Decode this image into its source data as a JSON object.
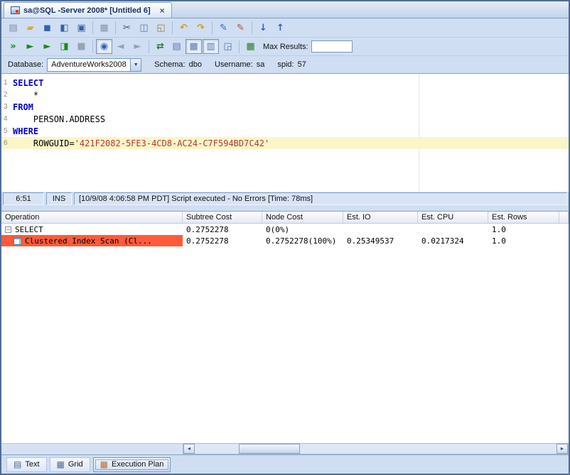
{
  "colors": {
    "accent": "#4f6d99",
    "keyword": "#0000cc",
    "string": "#b5382d",
    "current_line": "#fbf6c8",
    "selected_row": "#ff5a3a"
  },
  "icons": {
    "chevron_down": "▼",
    "scroll_left": "◄",
    "scroll_right": "►"
  },
  "doc_tab": {
    "title": "sa@SQL -Server 2008* [Untitled 6]",
    "close": "×"
  },
  "toolbar_main": {
    "file_group": [
      {
        "name": "new-file-button",
        "icon": "new-file-icon",
        "glyph": "▤",
        "style": "color:#7d8ca3"
      },
      {
        "name": "open-file-button",
        "icon": "open-folder-icon",
        "glyph": "▰",
        "style": "color:#dfa63e"
      },
      {
        "name": "save-button",
        "icon": "save-icon",
        "glyph": "◼",
        "style": "color:#3a5fa8"
      },
      {
        "name": "save-as-button",
        "icon": "save-as-icon",
        "glyph": "◧",
        "style": "color:#3a5fa8"
      },
      {
        "name": "save-all-button",
        "icon": "save-all-icon",
        "glyph": "▣",
        "style": "color:#3a5fa8"
      }
    ],
    "print_group": [
      {
        "name": "print-button",
        "icon": "printer-icon",
        "glyph": "▦",
        "style": "color:#8a95a8"
      }
    ],
    "clipboard_group": [
      {
        "name": "cut-button",
        "icon": "scissors-icon",
        "glyph": "✂",
        "style": "color:#44546e"
      },
      {
        "name": "copy-button",
        "icon": "copy-icon",
        "glyph": "◫",
        "style": "color:#5a77b0"
      },
      {
        "name": "paste-button",
        "icon": "paste-icon",
        "glyph": "◱",
        "style": "color:#a57c3f"
      }
    ],
    "undo_group": [
      {
        "name": "undo-button",
        "icon": "undo-arrow-icon",
        "glyph": "↶",
        "style": "color:#d89a20;font-weight:bold"
      },
      {
        "name": "redo-button",
        "icon": "redo-arrow-icon",
        "glyph": "↷",
        "style": "color:#d89a20;font-weight:bold"
      }
    ],
    "tools_group": [
      {
        "name": "edit-tool-button",
        "icon": "pencil-blue-icon",
        "glyph": "✎",
        "style": "color:#3468c8"
      },
      {
        "name": "edit-tool-2-button",
        "icon": "pencil-red-icon",
        "glyph": "✎",
        "style": "color:#c4483a"
      }
    ],
    "sort_group": [
      {
        "name": "sort-ascending-button",
        "icon": "arrow-down-icon",
        "glyph": "↓",
        "style": "color:#2a5fd0;font-weight:bold"
      },
      {
        "name": "sort-descending-button",
        "icon": "arrow-up-icon",
        "glyph": "↑",
        "style": "color:#2a5fd0;font-weight:bold"
      }
    ]
  },
  "toolbar_exec": {
    "run_group": [
      {
        "name": "execute-all-button",
        "icon": "double-chevron-icon",
        "glyph": "»",
        "style": "color:#1a8a1a;font-weight:bold"
      },
      {
        "name": "execute-button",
        "icon": "play-icon",
        "glyph": "►",
        "style": "color:#1a8a1a"
      },
      {
        "name": "execute-fetch-all-button",
        "icon": "play-fetch-icon",
        "glyph": "►",
        "style": "color:#1a8a1a"
      },
      {
        "name": "execute-batch-button",
        "icon": "play-grid-icon",
        "glyph": "◨",
        "style": "color:#1a8a1a"
      },
      {
        "name": "stop-button",
        "icon": "stop-icon",
        "glyph": "■",
        "style": "color:#9aa4b2"
      }
    ],
    "toggle_group": [
      {
        "name": "limit-results-toggle",
        "icon": "limit-icon",
        "glyph": "◉",
        "style": "color:#2a5fd0",
        "state": "pressed"
      }
    ],
    "nav_group": [
      {
        "name": "previous-statement-button",
        "icon": "arrow-left-icon",
        "glyph": "◄",
        "style": "color:#98a2b4"
      },
      {
        "name": "next-statement-button",
        "icon": "arrow-right-icon",
        "glyph": "►",
        "style": "color:#98a2b4"
      }
    ],
    "connect_group": [
      {
        "name": "reconnect-button",
        "icon": "swap-arrows-icon",
        "glyph": "⇄",
        "style": "color:#2a7a2a;font-weight:bold"
      }
    ],
    "results_group": [
      {
        "name": "results-text-toggle",
        "icon": "text-results-icon",
        "glyph": "▤",
        "style": "color:#5a77b0"
      },
      {
        "name": "results-grid-toggle",
        "icon": "grid-results-icon",
        "glyph": "▦",
        "style": "color:#5a77b0",
        "state": "pressed"
      },
      {
        "name": "results-single-row-toggle",
        "icon": "row-results-icon",
        "glyph": "▥",
        "style": "color:#5a77b0",
        "state": "pressed"
      },
      {
        "name": "export-results-button",
        "icon": "export-grid-icon",
        "glyph": "◲",
        "style": "color:#5a77b0"
      }
    ],
    "table_group": [
      {
        "name": "describe-table-button",
        "icon": "table-icon",
        "glyph": "▦",
        "style": "color:#2a7a2a"
      }
    ],
    "max_results_label": "Max Results:",
    "max_results_value": ""
  },
  "context": {
    "database_label": "Database:",
    "database_value": "AdventureWorks2008",
    "schema_label": "Schema:",
    "schema_value": "dbo",
    "username_label": "Username:",
    "username_value": "sa",
    "spid_label": "spid:",
    "spid_value": "57"
  },
  "editor": {
    "lines": [
      {
        "num": "1",
        "kw": "SELECT",
        "text": "",
        "str": ""
      },
      {
        "num": "2",
        "kw": "",
        "text": "    *",
        "str": ""
      },
      {
        "num": "3",
        "kw": "FROM",
        "text": "",
        "str": ""
      },
      {
        "num": "4",
        "kw": "",
        "text": "    PERSON.ADDRESS",
        "str": ""
      },
      {
        "num": "5",
        "kw": "WHERE",
        "text": "",
        "str": ""
      },
      {
        "num": "6",
        "kw": "",
        "text": "    ROWGUID=",
        "str": "'421F2082-5FE3-4CD8-AC24-C7F594BD7C42'"
      }
    ]
  },
  "status_bar": {
    "position": "6:51",
    "mode": "INS",
    "message": "[10/9/08 4:06:58 PM PDT] Script executed - No Errors [Time: 78ms]"
  },
  "plan": {
    "columns": [
      "Operation",
      "Subtree Cost",
      "Node Cost",
      "Est. IO",
      "Est. CPU",
      "Est. Rows"
    ],
    "rows": {
      "select": {
        "toggle": "−",
        "op": "SELECT",
        "subtree": "0.2752278",
        "node": "0(0%)",
        "io": "",
        "cpu": "",
        "rows": "1.0"
      },
      "scan": {
        "op": "Clustered Index Scan (Cl...",
        "subtree": "0.2752278",
        "node": "0.2752278(100%)",
        "io": "0.25349537",
        "cpu": "0.0217324",
        "rows": "1.0"
      }
    }
  },
  "bottom_tabs": [
    {
      "name": "tab-text",
      "icon": "text-results-icon",
      "glyph": "▤",
      "style": "color:#4a6a9a",
      "label": "Text"
    },
    {
      "name": "tab-grid",
      "icon": "grid-results-icon",
      "glyph": "▦",
      "style": "color:#4a6a9a",
      "label": "Grid"
    },
    {
      "name": "tab-execution-plan",
      "icon": "execution-plan-icon",
      "glyph": "▦",
      "style": "color:#c0662a",
      "label": "Execution Plan",
      "state": "active"
    }
  ]
}
